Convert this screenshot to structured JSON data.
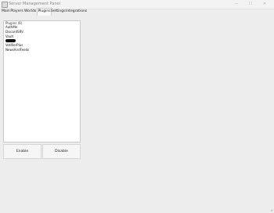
{
  "window": {
    "title": "Server Management Panel",
    "minimize_symbol": "—",
    "maximize_symbol": "☐",
    "close_symbol": "✕"
  },
  "tabs": [
    {
      "label": "Main"
    },
    {
      "label": "Players"
    },
    {
      "label": "Worlds"
    },
    {
      "label": "Plugins",
      "active": true
    },
    {
      "label": "Settings"
    },
    {
      "label": "Integrations"
    }
  ],
  "plugins_panel": {
    "header": "Plugins (6)",
    "items": [
      {
        "name": "AuthMe"
      },
      {
        "name": "DiscordSRV"
      },
      {
        "name": "Vault"
      },
      {
        "name": ""
      },
      {
        "name": "VotifierPlus"
      },
      {
        "name": "NewsAndFeeds"
      }
    ]
  },
  "buttons": {
    "enable": "Enable",
    "disable": "Disable"
  },
  "icons": {
    "app": "app-icon",
    "resize": "resize-grip-icon"
  }
}
